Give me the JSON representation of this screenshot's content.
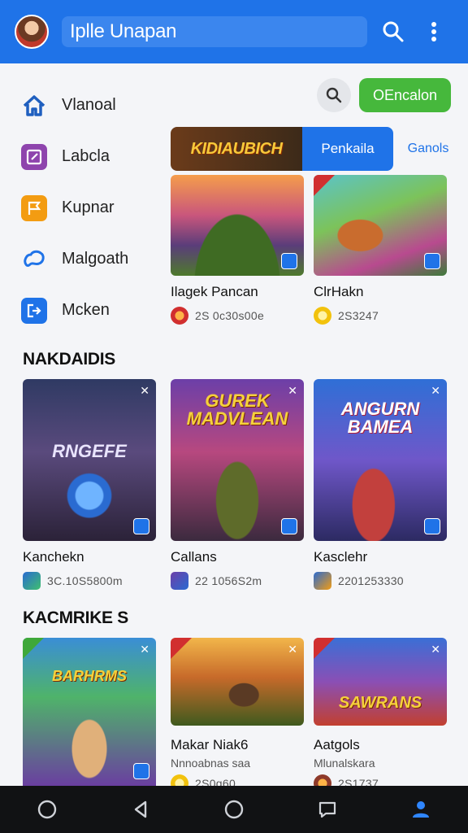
{
  "header": {
    "title": "Iplle Unapan"
  },
  "sidebar": {
    "items": [
      {
        "label": "Vlanoal",
        "color": "#1f5fbf",
        "icon": "home-icon"
      },
      {
        "label": "Labcla",
        "color": "#8e44ad",
        "icon": "edit-icon"
      },
      {
        "label": "Kupnar",
        "color": "#f39c12",
        "icon": "flag-icon"
      },
      {
        "label": "Malgoath",
        "color": "#1f73e8",
        "icon": "controller-icon"
      },
      {
        "label": "Mcken",
        "color": "#1f73e8",
        "icon": "exit-icon"
      }
    ]
  },
  "actions": {
    "green_button": "OEncalon"
  },
  "tabs": {
    "banner_text": "KIDIAUBICH",
    "active": "Penkaila",
    "other": "Ganols"
  },
  "featured": [
    {
      "title": "Ilagek Pancan",
      "meta": "2S 0c30s00e"
    },
    {
      "title": "ClrHakn",
      "meta": "2S3247"
    }
  ],
  "sections": [
    {
      "heading": "NAKDAIDIS",
      "cards": [
        {
          "title": "Kanchekn",
          "meta": "3C.10S5800m",
          "art_title": "RNGEFE"
        },
        {
          "title": "Callans",
          "meta": "22 1056S2m",
          "art_title": "GUREK MADVLEAN"
        },
        {
          "title": "Kasclehr",
          "meta": "2201253330",
          "art_title": "ANGURN BAMEA"
        }
      ]
    },
    {
      "heading": "KACMRIKE S",
      "cards": [
        {
          "title": "",
          "meta": "",
          "art_title": "BARHRMS"
        },
        {
          "title": "Makar Niak6",
          "sub": "Nnnoabnas saa",
          "meta": "2S0g60",
          "art_title": ""
        },
        {
          "title": "Aatgols",
          "sub": "Mlunalskara",
          "meta": "2S1737",
          "art_title": "SAWRANS"
        }
      ]
    }
  ],
  "colors": {
    "accent": "#1f73e8",
    "green": "#46b83c"
  }
}
